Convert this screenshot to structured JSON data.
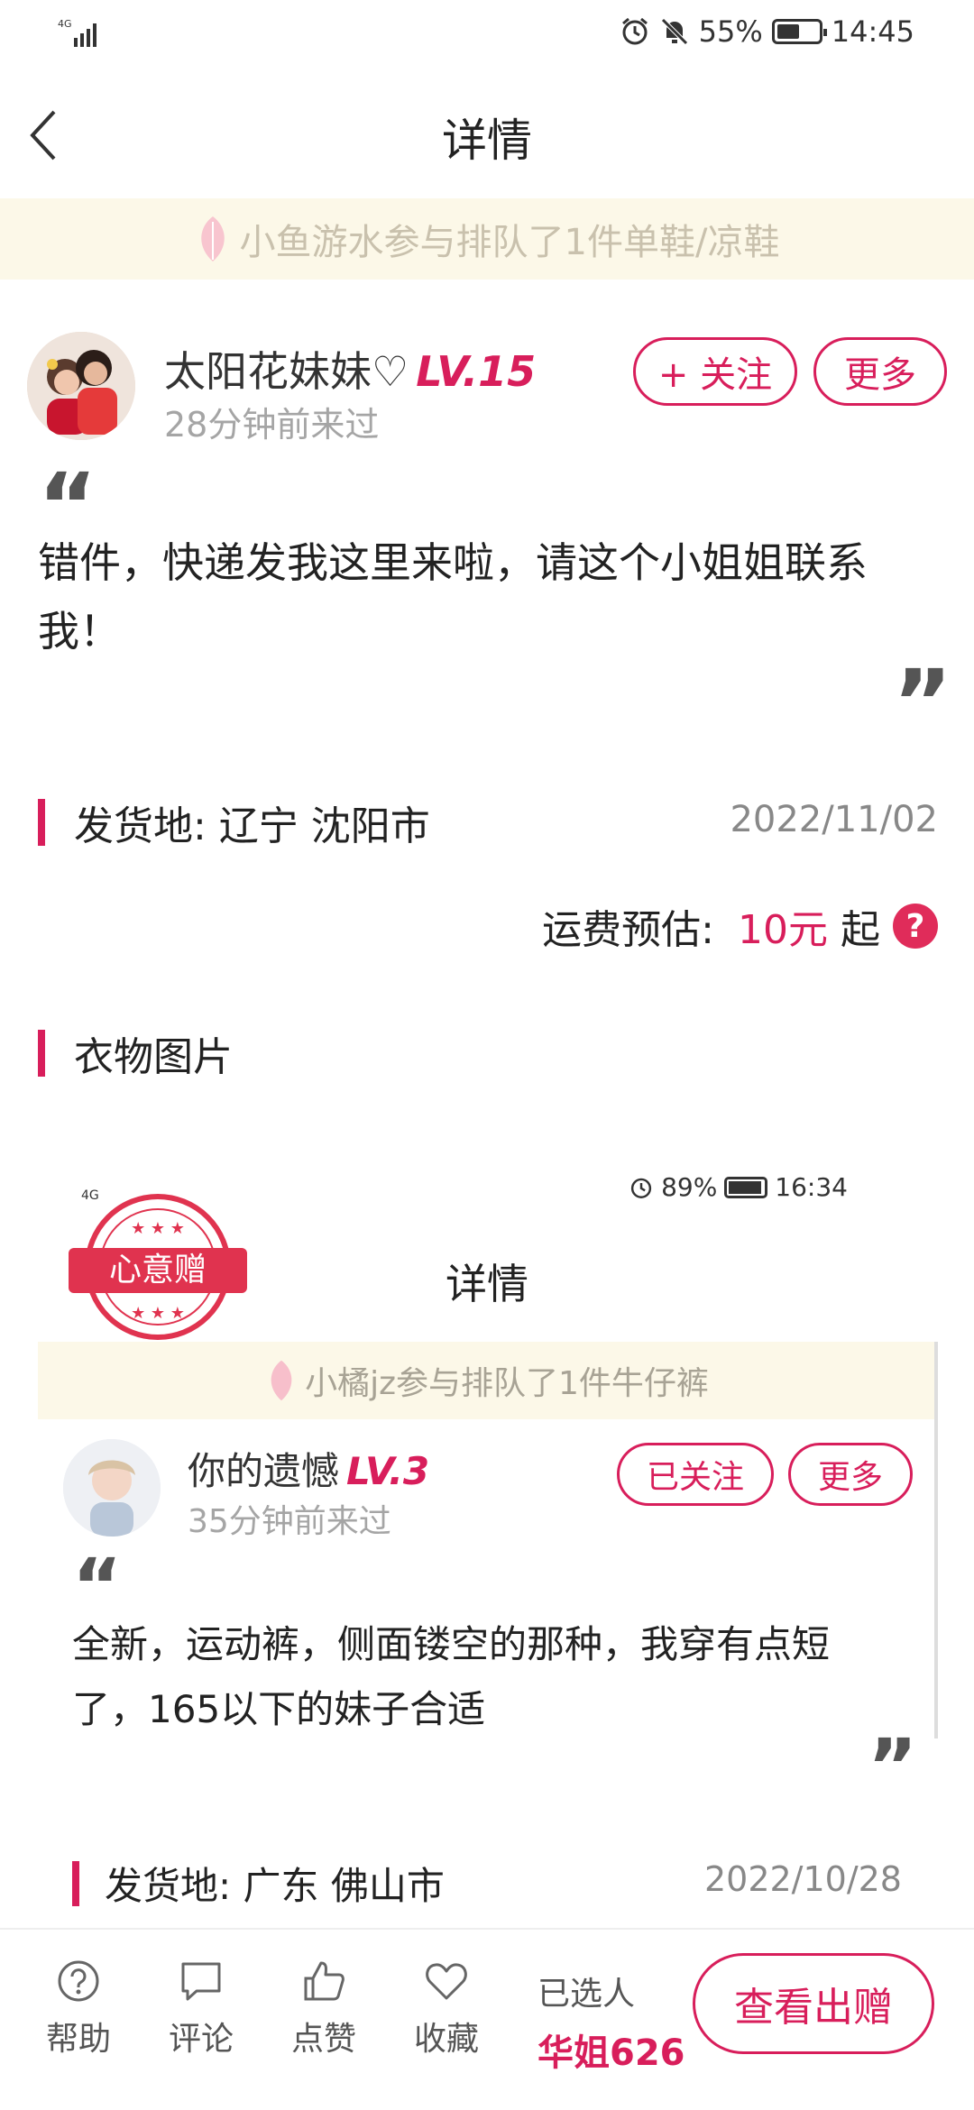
{
  "status_bar": {
    "network": "4G",
    "battery": "55%",
    "time": "14:45"
  },
  "nav": {
    "title": "详情"
  },
  "banner": {
    "text": "小鱼游水参与排队了1件单鞋/凉鞋"
  },
  "user": {
    "name": "太阳花妹妹♡",
    "level": "LV.15",
    "last_seen": "28分钟前来过",
    "follow_label": "+ 关注",
    "more_label": "更多"
  },
  "post": {
    "text": "错件，快递发我这里来啦，请这个小姐姐联系我！"
  },
  "ship_from": {
    "label": "发货地:  辽宁 沈阳市",
    "date": "2022/11/02"
  },
  "shipping": {
    "label": "运费预估:",
    "price": "10元",
    "suffix": "起",
    "help": "?"
  },
  "photos_section": {
    "label": "衣物图片"
  },
  "embedded": {
    "network": "4G",
    "battery": "89%",
    "time": "16:34",
    "stamp": "心意赠",
    "title": "详情",
    "banner": "小橘jz参与排队了1件牛仔裤",
    "user_name": "你的遗憾",
    "level": "LV.3",
    "last_seen": "35分钟前来过",
    "followed_label": "已关注",
    "more_label": "更多",
    "text": "全新，运动裤，侧面镂空的那种，我穿有点短了，165以下的妹子合适",
    "ship_from": "发货地:  广东 佛山市",
    "date": "2022/10/28"
  },
  "tabbar": {
    "help": "帮助",
    "comment": "评论",
    "like": "点赞",
    "favorite": "收藏",
    "selected_label": "已选人",
    "selected_name": "华姐626",
    "cta": "查看出赠"
  },
  "colors": {
    "accent": "#d81e5b",
    "banner_bg": "#fcf8e8"
  }
}
